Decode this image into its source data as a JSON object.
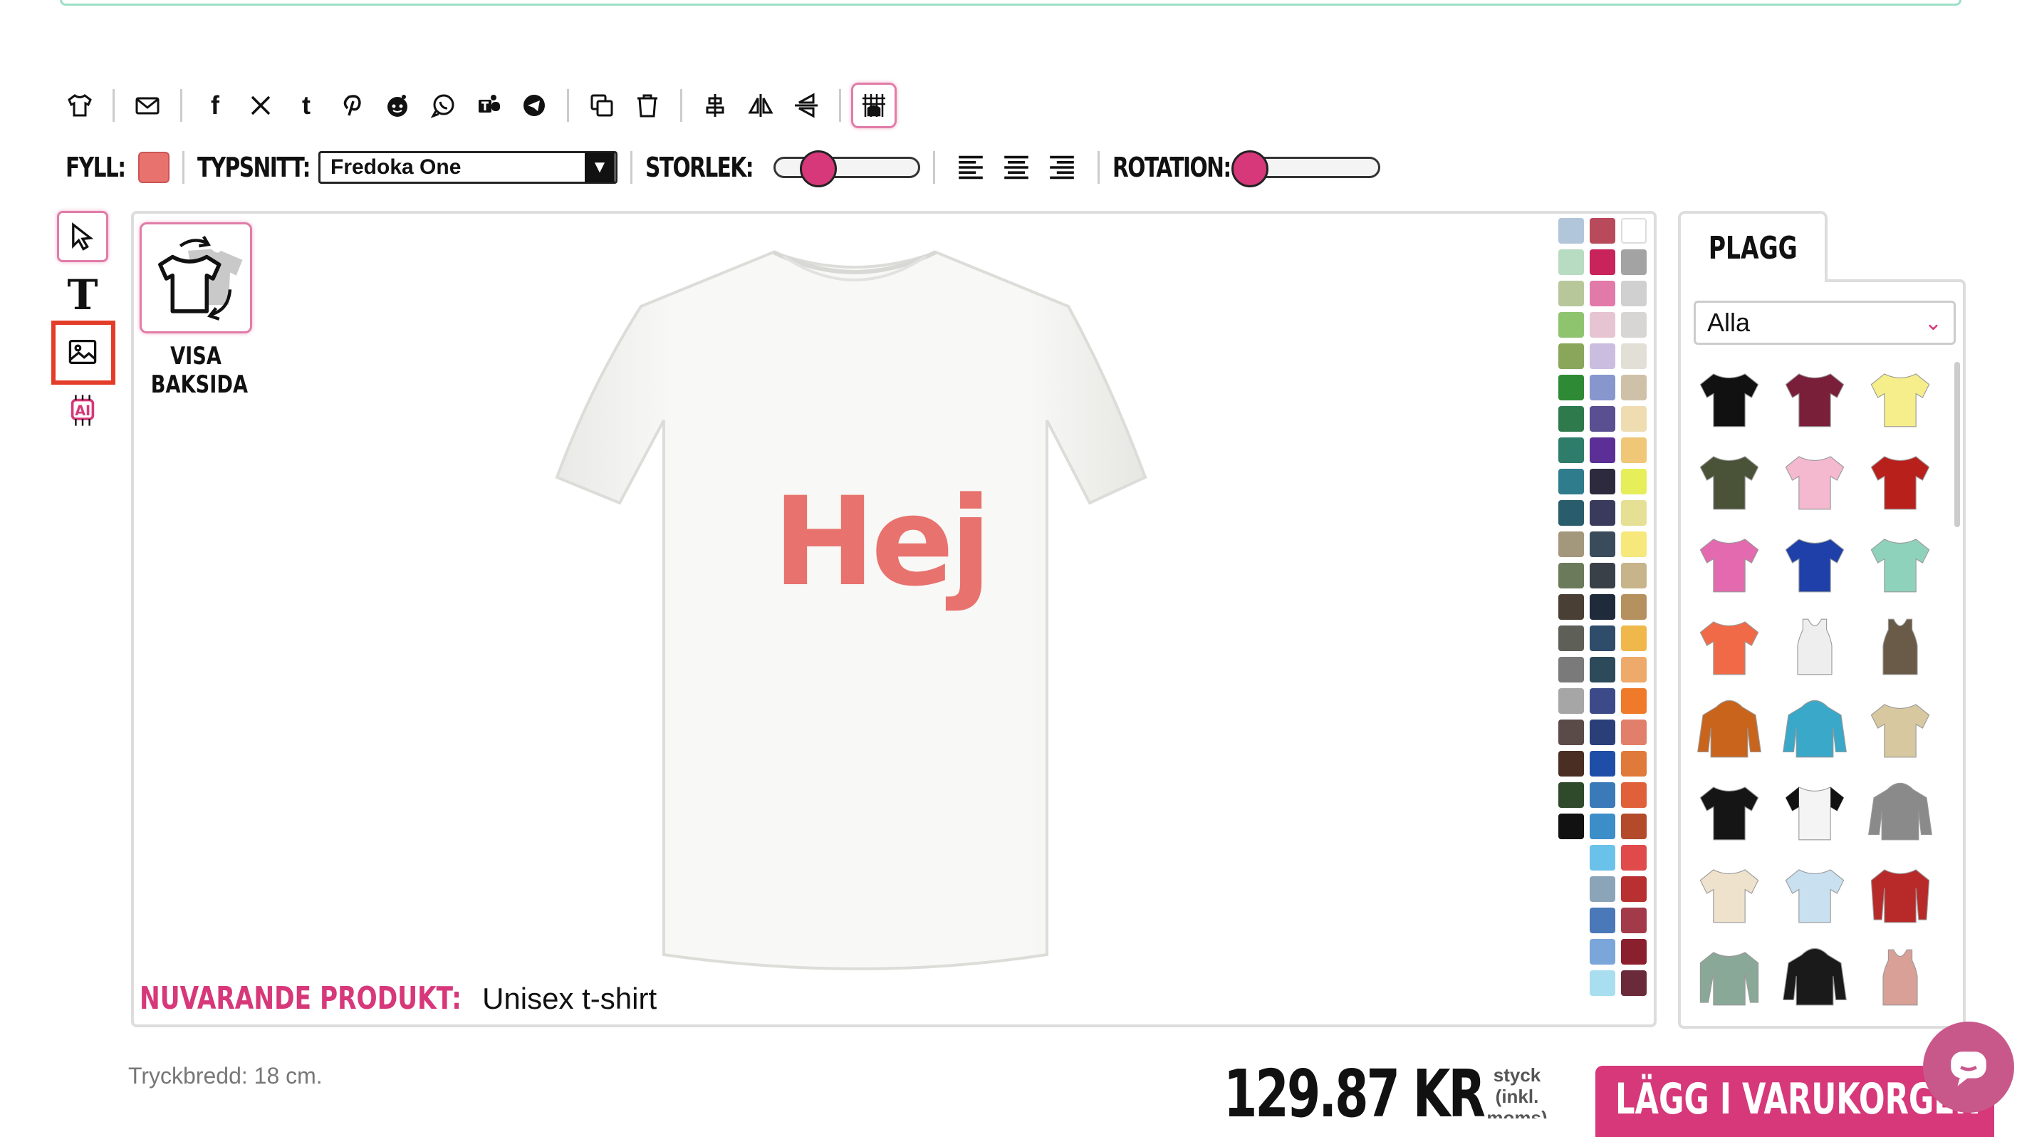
{
  "toolbar_top": {
    "icons": [
      "tshirt-icon",
      "email-icon",
      "facebook-icon",
      "x-icon",
      "tumblr-icon",
      "pinterest-icon",
      "reddit-icon",
      "whatsapp-icon",
      "teams-icon",
      "telegram-icon",
      "copy-icon",
      "trash-icon",
      "align-center-icon",
      "flip-horizontal-icon",
      "flip-vertical-icon",
      "grid-icon"
    ]
  },
  "toolbar_text": {
    "fill_label": "FYLL:",
    "fill_color": "#e8726d",
    "font_label": "TYPSNITT:",
    "font_value": "Fredoka One",
    "size_label": "STORLEK:",
    "size_value": 0.28,
    "rotation_label": "ROTATION:",
    "rotation_value": 0.0
  },
  "tools": [
    "select-tool-icon",
    "text-tool-icon",
    "image-tool-icon",
    "ai-tool-icon"
  ],
  "canvas": {
    "back_label_1": "VISA",
    "back_label_2": "BAKSIDA",
    "design_text": "Hej",
    "product_label": "NUVARANDE PRODUKT:",
    "product_name": "Unisex t-shirt"
  },
  "palette": [
    "#b2c6da",
    "#b84a5c",
    "#ffffff",
    "#b7dcc2",
    "#c8235a",
    "#a3a3a3",
    "#b7c79a",
    "#e27aa9",
    "#d0d0d0",
    "#8ec46e",
    "#e6c4d1",
    "#d8d6d4",
    "#8aa65a",
    "#cbbde0",
    "#e2dfd6",
    "#2e8a34",
    "#8796cc",
    "#cfc1a7",
    "#2f7a4d",
    "#5a4f91",
    "#efdcb0",
    "#2e7c6a",
    "#5b2f95",
    "#f0c776",
    "#2f7c8c",
    "#2d2a3e",
    "#e6ee5a",
    "#2a5d6b",
    "#3a3a5c",
    "#e5e093",
    "#a4987c",
    "#3a4c5b",
    "#f6e87a",
    "#6c7a5c",
    "#3a4048",
    "#c8b48a",
    "#4a3f34",
    "#1f2a3a",
    "#b69160",
    "#5e6058",
    "#2f4c6a",
    "#f0b84a",
    "#7a7a7a",
    "#2c4a5a",
    "#eeaa6a",
    "#a6a6a6",
    "#3d4a8a",
    "#ef7a2a",
    "#5a4a48",
    "#2a3f78",
    "#e17f6a",
    "#4a2e24",
    "#1e4ea8",
    "#e07a3a",
    "#2f4a2a",
    "#3a7ab8",
    "#e0603a",
    "#111111",
    "#3b8ec8",
    "#b34a2a",
    null,
    "#6ac2ea",
    "#e04a4a",
    null,
    "#8ca4b8",
    "#b8302f",
    null,
    "#4a78b8",
    "#a33a4a",
    null,
    "#7aa6da",
    "#8a1f2e",
    null,
    "#a8def0",
    "#6a2a3a"
  ],
  "garment_panel": {
    "tab_label": "PLAGG",
    "filter_value": "Alla",
    "items": [
      {
        "name": "black-tshirt",
        "color": "#111111",
        "kind": "tee"
      },
      {
        "name": "burgundy-tshirt",
        "color": "#7a1f3a",
        "kind": "tee"
      },
      {
        "name": "yellow-tshirt",
        "color": "#f5ee8a",
        "kind": "tee"
      },
      {
        "name": "olive-tshirt",
        "color": "#4a5238",
        "kind": "tee"
      },
      {
        "name": "pink-tshirt",
        "color": "#f4b8cf",
        "kind": "tee"
      },
      {
        "name": "red-tshirt",
        "color": "#b8201c",
        "kind": "tee"
      },
      {
        "name": "magenta-tshirt",
        "color": "#e36aae",
        "kind": "tee"
      },
      {
        "name": "blue-tshirt",
        "color": "#1e40a8",
        "kind": "tee"
      },
      {
        "name": "mint-tshirt",
        "color": "#8fd2bc",
        "kind": "tee"
      },
      {
        "name": "orange-tshirt",
        "color": "#f06a48",
        "kind": "tee"
      },
      {
        "name": "white-tank",
        "color": "#eeeeee",
        "kind": "tank"
      },
      {
        "name": "brown-tank",
        "color": "#6a5a48",
        "kind": "tank"
      },
      {
        "name": "orange-hoodie",
        "color": "#c8641c",
        "kind": "hoodie"
      },
      {
        "name": "turquoise-hoodie",
        "color": "#3aa8c8",
        "kind": "hoodie"
      },
      {
        "name": "tiedye-tshirt",
        "color": "#d8c8a0",
        "kind": "tee"
      },
      {
        "name": "black-tshirt-2",
        "color": "#151515",
        "kind": "tee"
      },
      {
        "name": "raglan-tshirt",
        "color": "#f4f4f4",
        "kind": "raglan"
      },
      {
        "name": "grey-hoodie",
        "color": "#8a8a8a",
        "kind": "hoodie"
      },
      {
        "name": "natural-tshirt",
        "color": "#efe2cc",
        "kind": "tee"
      },
      {
        "name": "lightblue-tshirt",
        "color": "#c8e0f0",
        "kind": "tee"
      },
      {
        "name": "varsity-jacket",
        "color": "#b82a2a",
        "kind": "jacket"
      },
      {
        "name": "sage-longsleeve",
        "color": "#8aa898",
        "kind": "long"
      },
      {
        "name": "black-orange-hoodie",
        "color": "#1a1a1a",
        "kind": "hoodie"
      },
      {
        "name": "dustypink-tank",
        "color": "#d8a096",
        "kind": "tank"
      }
    ]
  },
  "footer": {
    "print_width": "Tryckbredd: 18 cm.",
    "price": "129.87 KR",
    "per_piece": "styck\n(inkl.\nmoms)",
    "add_to_cart": "LÄGG I VARUKORGEN"
  },
  "colors": {
    "accent": "#d6387a",
    "highlight": "#e33d2a",
    "design": "#e8726d"
  }
}
